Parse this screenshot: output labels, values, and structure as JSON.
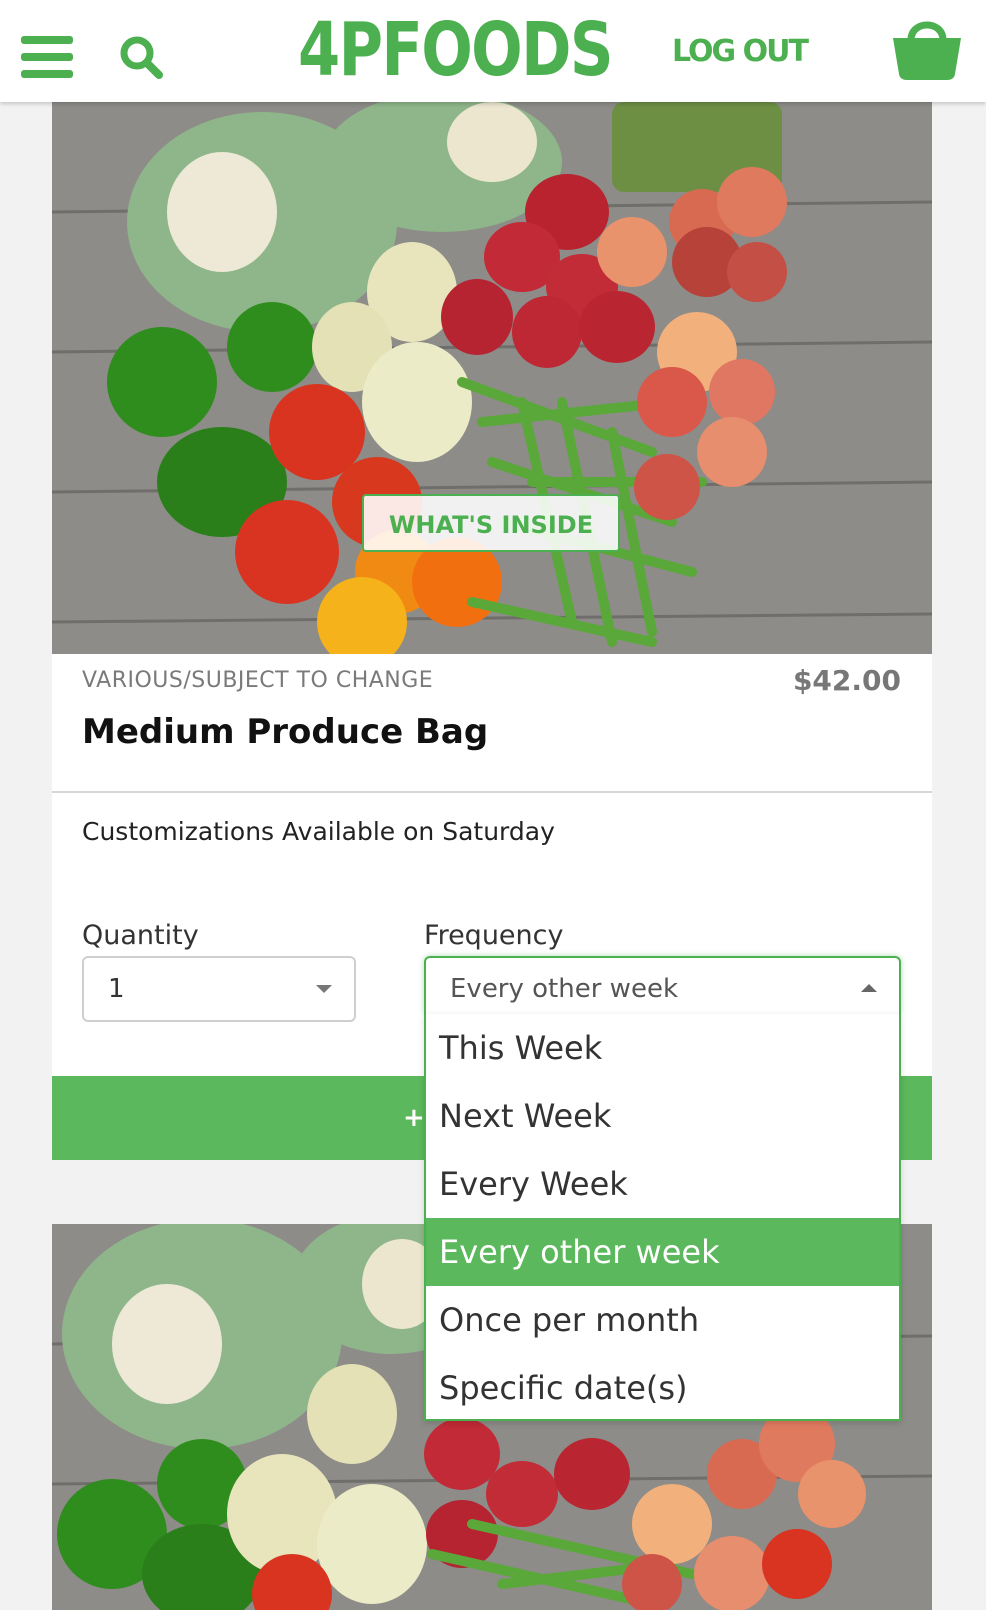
{
  "header": {
    "logo_text": "4PFOODS",
    "logout_label": "LOG OUT",
    "icons": [
      "hamburger-menu-icon",
      "search-icon",
      "shopping-bag-icon"
    ],
    "brand_color": "#4caf50"
  },
  "product": {
    "overlay_button": "WHAT'S INSIDE",
    "category": "VARIOUS/SUBJECT TO CHANGE",
    "price": "$42.00",
    "name": "Medium Produce Bag",
    "customization_note": "Customizations Available on Saturday",
    "quantity_label": "Quantity",
    "quantity_value": "1",
    "frequency_label": "Frequency",
    "frequency_value": "Every other week",
    "add_button_visible_text": "+ AD"
  },
  "frequency_dropdown": {
    "options": [
      {
        "label": "This Week",
        "selected": false
      },
      {
        "label": "Next Week",
        "selected": false
      },
      {
        "label": "Every Week",
        "selected": false
      },
      {
        "label": "Every other week",
        "selected": true
      },
      {
        "label": "Once per month",
        "selected": false
      },
      {
        "label": "Specific date(s)",
        "selected": false
      }
    ],
    "selected_color": "#5cb85c"
  }
}
